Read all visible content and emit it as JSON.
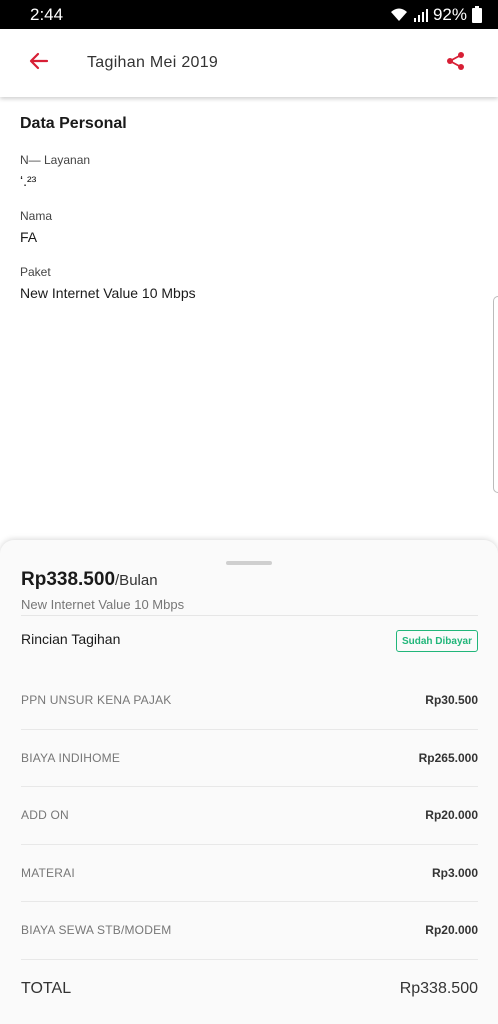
{
  "status_bar": {
    "time": "2:44",
    "battery": "92%",
    "icons": [
      "wifi-icon",
      "signal-icon",
      "battery-icon"
    ]
  },
  "app_bar": {
    "title": "Tagihan Mei 2019",
    "back_icon": "arrow-left-icon",
    "share_icon": "share-icon",
    "accent_color": "#d71f35"
  },
  "personal": {
    "section_title": "Data Personal",
    "fields": [
      {
        "label": "N— Layanan",
        "value": "ʻ.²³"
      },
      {
        "label": "Nama",
        "value": "FA"
      },
      {
        "label": "Paket",
        "value": "New Internet Value 10 Mbps"
      }
    ]
  },
  "bill": {
    "amount": "Rp338.500",
    "period": "/Bulan",
    "package": "New Internet Value 10 Mbps",
    "details_title": "Rincian Tagihan",
    "status": "Sudah Dibayar",
    "status_color": "#21b67a",
    "items": [
      {
        "label": "PPN UNSUR KENA PAJAK",
        "value": "Rp30.500"
      },
      {
        "label": "BIAYA INDIHOME",
        "value": "Rp265.000"
      },
      {
        "label": "ADD ON",
        "value": "Rp20.000"
      },
      {
        "label": "MATERAI",
        "value": "Rp3.000"
      },
      {
        "label": "BIAYA SEWA STB/MODEM",
        "value": "Rp20.000"
      }
    ],
    "total_label": "TOTAL",
    "total_value": "Rp338.500"
  }
}
